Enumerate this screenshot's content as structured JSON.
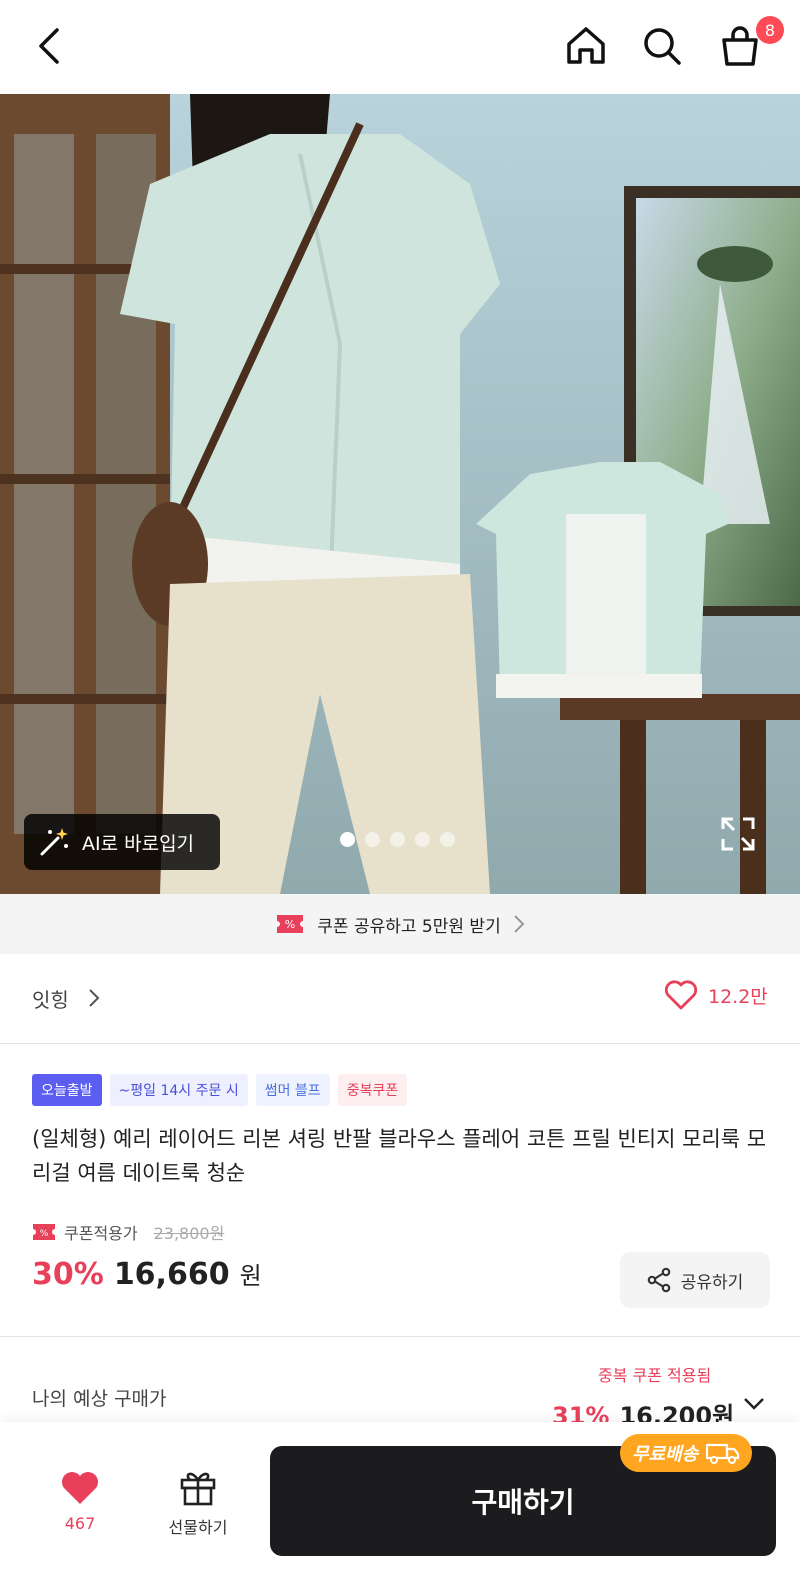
{
  "header": {
    "cart_count": "8"
  },
  "hero": {
    "ai_button_label": "AI로 바로입기",
    "slide_count": 5,
    "active_slide": 1
  },
  "coupon_bar": {
    "label": "쿠폰 공유하고 5만원 받기"
  },
  "brand": {
    "name": "잇힝",
    "like_count": "12.2만"
  },
  "tags": [
    {
      "label": "오늘출발"
    },
    {
      "label": "~평일 14시 주문 시"
    },
    {
      "label": "썸머 블프"
    },
    {
      "label": "중복쿠폰"
    }
  ],
  "product": {
    "title": "(일체형) 예리 레이어드 리본 셔링 반팔 블라우스 플레어 코튼 프릴 빈티지 모리룩 모리걸 여름 데이트룩 청순",
    "coupon_price_label": "쿠폰적용가",
    "original_price": "23,800원",
    "discount": "30%",
    "price": "16,660",
    "currency": "원",
    "share_label": "공유하기"
  },
  "expected": {
    "label": "나의 예상 구매가",
    "applied_label": "중복 쿠폰 적용됨",
    "discount": "31%",
    "price": "16,200원"
  },
  "bottom_bar": {
    "like_count": "467",
    "gift_label": "선물하기",
    "buy_label": "구매하기",
    "free_shipping_label": "무료배송"
  },
  "colors": {
    "accent_red": "#e8405a",
    "badge_red": "#ff4b55",
    "dark_button": "#1c1c1e",
    "free_ship_orange": "#ffa51f",
    "tag_purple": "#5b5ef0"
  }
}
